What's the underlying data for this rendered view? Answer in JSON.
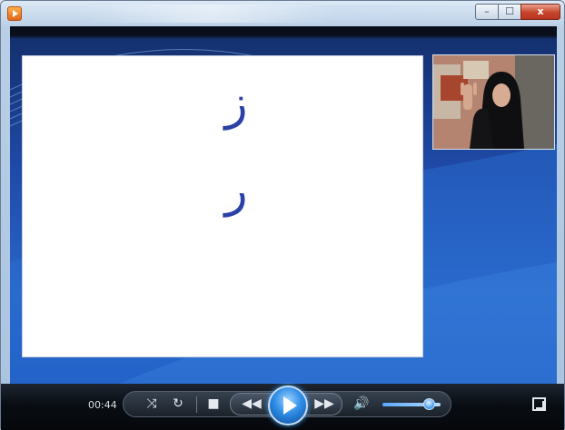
{
  "window": {
    "caption_min": "–",
    "caption_max": "☐",
    "caption_close": "x"
  },
  "slide": {
    "letters": [
      "ز",
      "ر"
    ]
  },
  "player": {
    "time": "00:44",
    "icons": [
      "shuffle-icon",
      "repeat-icon",
      "stop-icon",
      "previous-icon",
      "play-icon",
      "next-icon",
      "volume-icon",
      "switch-to-library-icon"
    ],
    "volume_level": 0.8
  },
  "colors": {
    "letter": "#2a41a6",
    "accent": "#2f8de6"
  }
}
